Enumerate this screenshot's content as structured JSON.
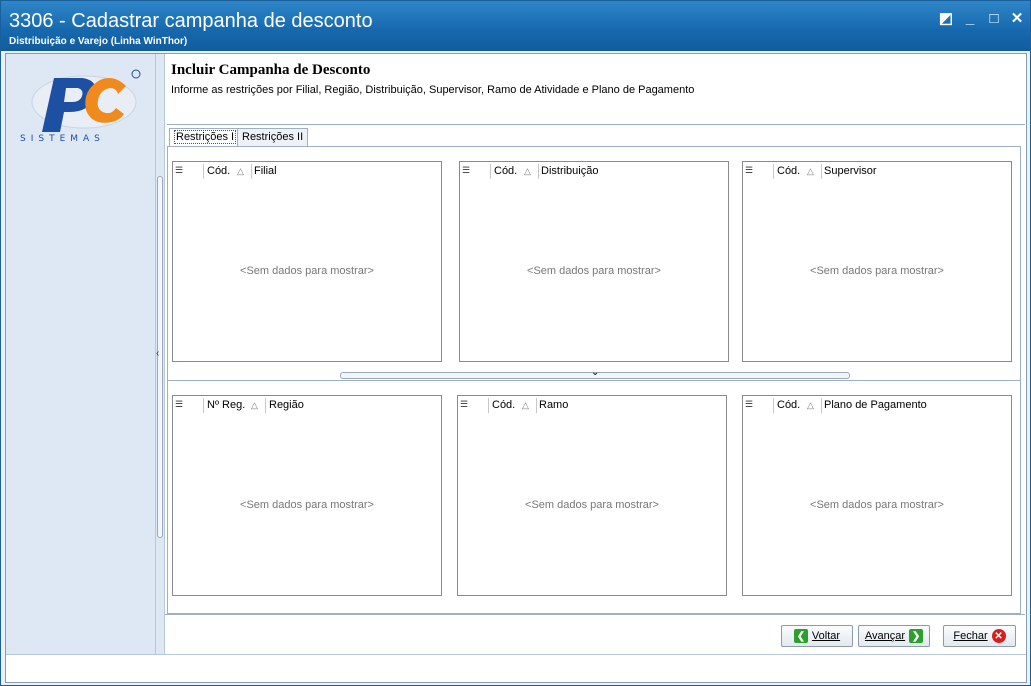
{
  "window": {
    "title": "3306 - Cadastrar campanha de desconto",
    "subtitle": "Distribuição e Varejo (Linha WinThor)",
    "controls": [
      "restore-icon",
      "minimize-icon",
      "maximize-icon",
      "close-icon"
    ]
  },
  "logo": {
    "text": "SISTEMAS",
    "brand": "PC",
    "colors": {
      "blue": "#1d4fa3",
      "orange": "#f08a1c"
    }
  },
  "header": {
    "title": "Incluir Campanha de Desconto",
    "description": "Informe as restrições por Filial, Região, Distribuição, Supervisor, Ramo de Atividade e Plano de Pagamento"
  },
  "tabs": [
    {
      "label": "Restrições I",
      "active": true
    },
    {
      "label": "Restrições II",
      "active": false
    }
  ],
  "grids": {
    "filial": {
      "col1": "Cód.",
      "col2": "Filial",
      "empty": "<Sem dados para mostrar>"
    },
    "distribuicao": {
      "col1": "Cód.",
      "col2": "Distribuição",
      "empty": "<Sem dados para mostrar>"
    },
    "supervisor": {
      "col1": "Cód.",
      "col2": "Supervisor",
      "empty": "<Sem dados para mostrar>"
    },
    "regiao": {
      "col1": "Nº Reg.",
      "col2": "Região",
      "empty": "<Sem dados para mostrar>"
    },
    "ramo": {
      "col1": "Cód.",
      "col2": "Ramo",
      "empty": "<Sem dados para mostrar>"
    },
    "plano": {
      "col1": "Cód.",
      "col2": "Plano de Pagamento",
      "empty": "<Sem dados para mostrar>"
    }
  },
  "buttons": {
    "voltar": {
      "label": "Voltar",
      "icon": "arrow-left-icon"
    },
    "avancar": {
      "label": "Avançar",
      "icon": "arrow-right-icon"
    },
    "fechar": {
      "label": "Fechar",
      "icon": "close-circle-icon"
    }
  },
  "colors": {
    "titlebar": "#1668ad",
    "sidebar": "#dde8f4",
    "accent_green": "#2ca02c",
    "accent_red": "#d62020"
  }
}
